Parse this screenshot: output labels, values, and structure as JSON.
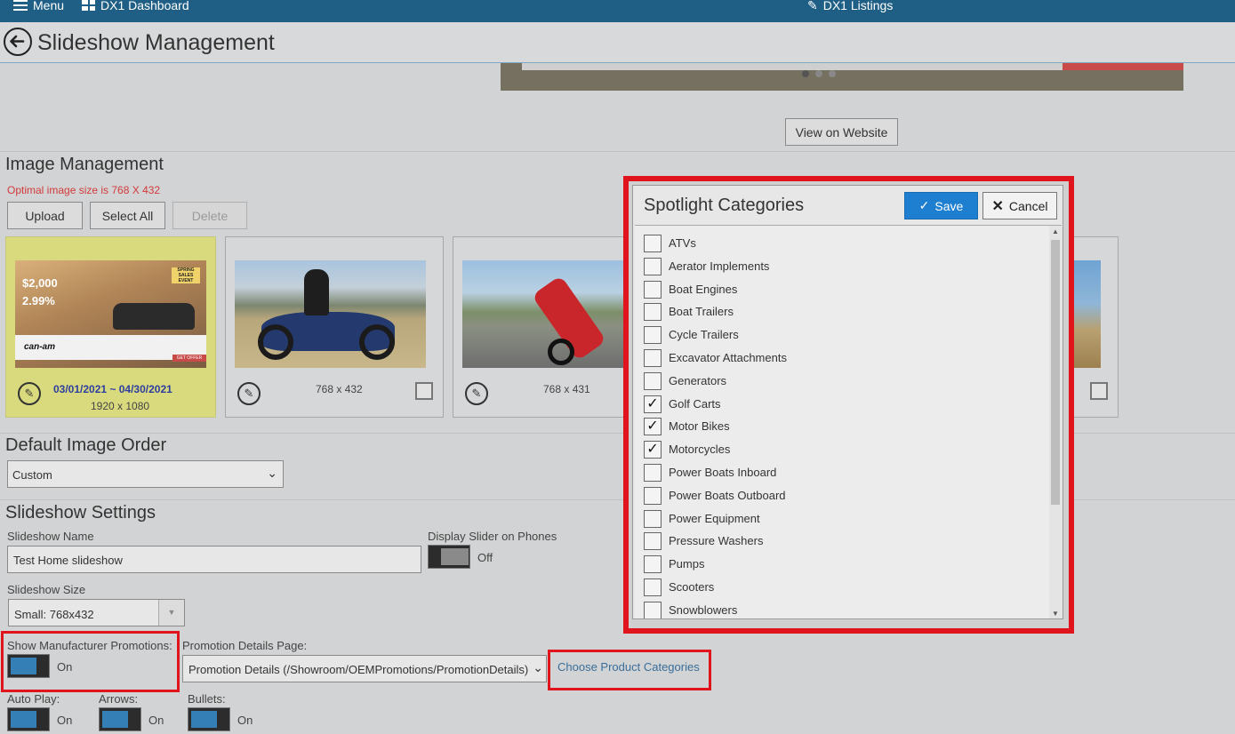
{
  "topbar": {
    "menu": "Menu",
    "dashboard": "DX1 Dashboard",
    "listings": "DX1 Listings"
  },
  "page": {
    "title": "Slideshow Management"
  },
  "view_website": "View on Website",
  "image_mgmt": {
    "title": "Image Management",
    "hint": "Optimal image size is 768 X 432",
    "upload": "Upload",
    "select_all": "Select All",
    "delete": "Delete",
    "cards": [
      {
        "dates": "03/01/2021 ~ 04/30/2021",
        "size": "1920 x 1080",
        "promo_amount": "$2,000",
        "promo_rate": "2.99%",
        "promo_badge": "SPRING SALES EVENT",
        "brand": "can-am",
        "cta": "GET OFFER"
      },
      {
        "size": "768 x 432"
      },
      {
        "size": "768 x 431"
      }
    ]
  },
  "order": {
    "title": "Default Image Order",
    "value": "Custom"
  },
  "settings": {
    "title": "Slideshow Settings",
    "name_label": "Slideshow Name",
    "name_value": "Test Home slideshow",
    "phones_label": "Display Slider on Phones",
    "phones_state": "Off",
    "size_label": "Slideshow Size",
    "size_value": "Small: 768x432",
    "promos_label": "Show Manufacturer Promotions:",
    "promos_state": "On",
    "promo_page_label": "Promotion Details Page:",
    "promo_page_value": "Promotion Details (/Showroom/OEMPromotions/PromotionDetails)",
    "choose_link": "Choose Product Categories",
    "autoplay_label": "Auto Play:",
    "autoplay_state": "On",
    "arrows_label": "Arrows:",
    "arrows_state": "On",
    "bullets_label": "Bullets:",
    "bullets_state": "On"
  },
  "modal": {
    "title": "Spotlight Categories",
    "save": "Save",
    "cancel": "Cancel",
    "categories": [
      {
        "label": "ATVs",
        "checked": false
      },
      {
        "label": "Aerator Implements",
        "checked": false
      },
      {
        "label": "Boat Engines",
        "checked": false
      },
      {
        "label": "Boat Trailers",
        "checked": false
      },
      {
        "label": "Cycle Trailers",
        "checked": false
      },
      {
        "label": "Excavator Attachments",
        "checked": false
      },
      {
        "label": "Generators",
        "checked": false
      },
      {
        "label": "Golf Carts",
        "checked": true
      },
      {
        "label": "Motor Bikes",
        "checked": true
      },
      {
        "label": "Motorcycles",
        "checked": true
      },
      {
        "label": "Power Boats Inboard",
        "checked": false
      },
      {
        "label": "Power Boats Outboard",
        "checked": false
      },
      {
        "label": "Power Equipment",
        "checked": false
      },
      {
        "label": "Pressure Washers",
        "checked": false
      },
      {
        "label": "Pumps",
        "checked": false
      },
      {
        "label": "Scooters",
        "checked": false
      },
      {
        "label": "Snowblowers",
        "checked": false
      }
    ]
  },
  "colors": {
    "topbar": "#1f5f86",
    "accent": "#1e7fd1",
    "highlight": "#e0141c",
    "selected_card": "#d9d97e"
  }
}
